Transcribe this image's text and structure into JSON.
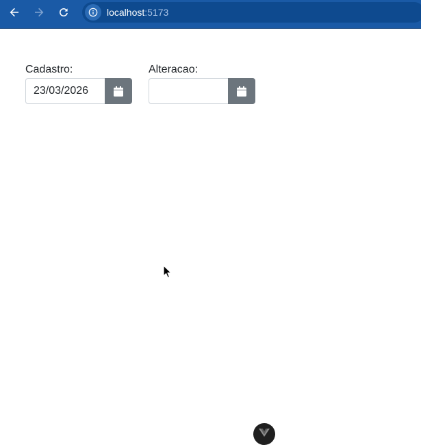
{
  "browser": {
    "url_host": "localhost",
    "url_port": ":5173",
    "icons": [
      "back-arrow-icon",
      "forward-arrow-icon",
      "reload-icon",
      "site-info-icon"
    ]
  },
  "form": {
    "cadastro": {
      "label": "Cadastro:",
      "value": "23/03/2026",
      "button_icon": "calendar-icon"
    },
    "alteracao": {
      "label": "Alteracao:",
      "value": "",
      "button_icon": "calendar-icon"
    }
  },
  "colors": {
    "browser_bar": "#1a5aa6",
    "calendar_button": "#6c757d"
  },
  "overlay": {
    "devtools_icon": "vue-logo-icon"
  }
}
